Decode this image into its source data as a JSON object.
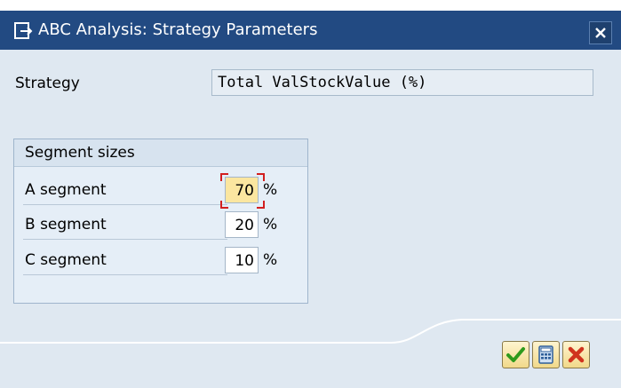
{
  "window": {
    "title": "ABC Analysis: Strategy Parameters"
  },
  "strategy": {
    "label": "Strategy",
    "value": "Total ValStockValue (%)"
  },
  "segment_sizes": {
    "title": "Segment sizes",
    "rows": [
      {
        "label": "A segment",
        "value": "70",
        "unit": "%"
      },
      {
        "label": "B segment",
        "value": "20",
        "unit": "%"
      },
      {
        "label": "C segment",
        "value": "10",
        "unit": "%"
      }
    ]
  },
  "colors": {
    "titlebar": "#224a82",
    "body": "#dfe8f1",
    "focus_field": "#fbe6a0",
    "focus_marker": "#d21f1f",
    "ok_green": "#2e9a1c",
    "cancel_red": "#d0331e"
  },
  "icons": {
    "app": "dialog-icon",
    "close": "close-icon",
    "ok": "checkmark-icon",
    "calc": "calculator-icon",
    "cancel": "cancel-icon"
  }
}
